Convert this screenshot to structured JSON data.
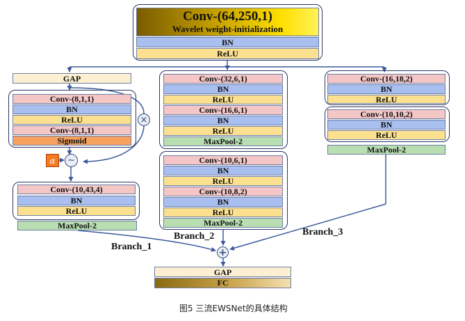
{
  "head": {
    "conv": "Conv-(64,250,1)",
    "subtitle": "Wavelet weight-initialization",
    "bn": "BN",
    "relu": "ReLU"
  },
  "branch1": {
    "label": "Branch_1",
    "gap": "GAP",
    "attention": [
      "Conv-(8,1,1)",
      "BN",
      "ReLU",
      "Conv-(8,1,1)",
      "Sigmoid"
    ],
    "alpha_symbol": "α",
    "multiply_symbol": "×",
    "activation_symbol": "∼",
    "conv_block": [
      "Conv-(10,43,4)",
      "BN",
      "ReLU"
    ],
    "pool": "MaxPool-2"
  },
  "branch2": {
    "label": "Branch_2",
    "block1": [
      "Conv-(32,6,1)",
      "BN",
      "ReLU",
      "Conv-(16,6,1)",
      "BN",
      "ReLU",
      "MaxPool-2"
    ],
    "block2": [
      "Conv-(10,6,1)",
      "BN",
      "ReLU",
      "Conv-(10,8,2)",
      "BN",
      "ReLU",
      "MaxPool-2"
    ]
  },
  "branch3": {
    "label": "Branch_3",
    "block1": [
      "Conv-(16,18,2)",
      "BN",
      "ReLU"
    ],
    "block2": [
      "Conv-(10,10,2)",
      "BN",
      "ReLU"
    ],
    "pool": "MaxPool-2"
  },
  "merge": {
    "plus_symbol": "+",
    "gap": "GAP",
    "fc": "FC"
  },
  "caption": "图5 三流EWSNet的具体结构"
}
